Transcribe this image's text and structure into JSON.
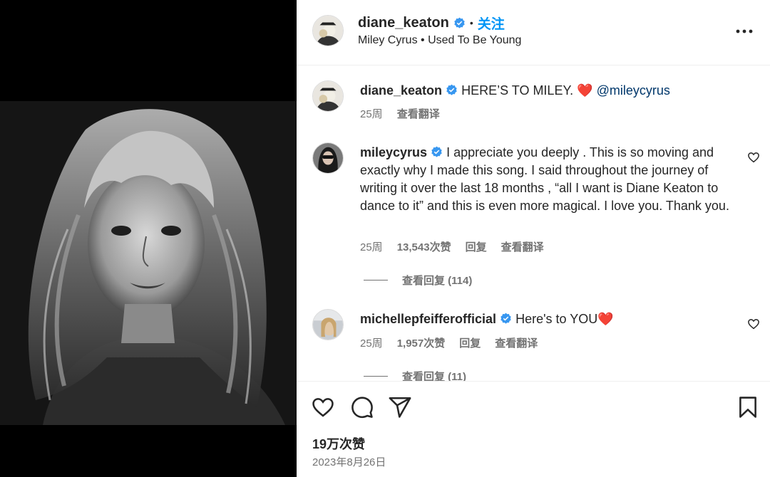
{
  "header": {
    "username": "diane_keaton",
    "follow_label": "关注",
    "audio": {
      "artist": "Miley Cyrus",
      "separator": "•",
      "track": "Used To Be Young"
    }
  },
  "caption": {
    "username": "diane_keaton",
    "text": "HERE’S TO MILEY. ❤️",
    "mention": "@mileycyrus",
    "time": "25周",
    "translate": "查看翻译"
  },
  "comments": [
    {
      "username": "mileycyrus",
      "text": "I appreciate you deeply . This is so moving and exactly why I made this song. I said throughout the journey of writing it over the last 18 months , “all I want is Diane Keaton to dance to it” and this is even more magical. I love you. Thank you.",
      "time": "25周",
      "likes": "13,543次赞",
      "reply": "回复",
      "translate": "查看翻译",
      "view_replies": "查看回复 (114)"
    },
    {
      "username": "michellepfeifferofficial",
      "text": "Here's to YOU❤️",
      "time": "25周",
      "likes": "1,957次赞",
      "reply": "回复",
      "translate": "查看翻译",
      "view_replies": "查看回复 (11)"
    }
  ],
  "footer": {
    "likes": "19万次赞",
    "date": "2023年8月26日"
  },
  "colors": {
    "accent": "#0095f6",
    "verified": "#3897f0",
    "mention": "#00376b",
    "secondary_text": "#737373"
  }
}
